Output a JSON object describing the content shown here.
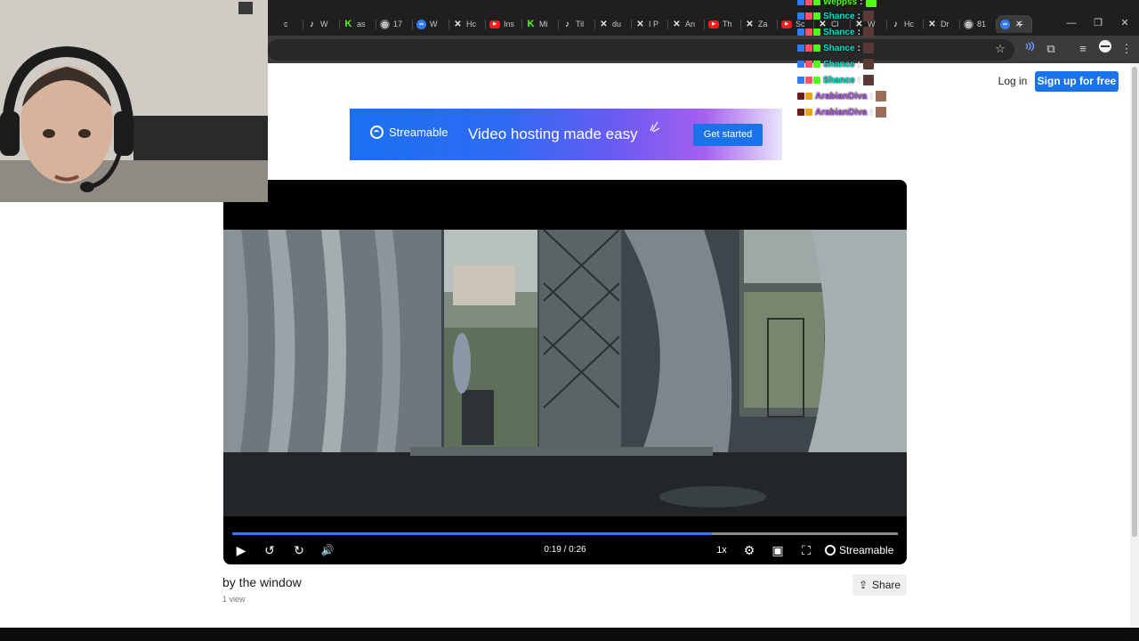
{
  "browser": {
    "tabs": [
      {
        "favicon": "partial-tab",
        "label": "c"
      },
      {
        "favicon": "tiktok-icon",
        "label": "W"
      },
      {
        "favicon": "kick-icon",
        "label": "as"
      },
      {
        "favicon": "globe-icon",
        "label": "17"
      },
      {
        "favicon": "streamable-icon",
        "label": "W"
      },
      {
        "favicon": "x-icon",
        "label": "Hc"
      },
      {
        "favicon": "youtube-icon",
        "label": "Ins"
      },
      {
        "favicon": "kick-icon",
        "label": "Mi"
      },
      {
        "favicon": "tiktok-icon",
        "label": "Til"
      },
      {
        "favicon": "x-icon",
        "label": "du"
      },
      {
        "favicon": "x-icon",
        "label": "I P"
      },
      {
        "favicon": "x-icon",
        "label": "An"
      },
      {
        "favicon": "youtube-icon",
        "label": "Th"
      },
      {
        "favicon": "x-icon",
        "label": "Za"
      },
      {
        "favicon": "youtube-icon",
        "label": "Sc"
      },
      {
        "favicon": "x-icon",
        "label": "Cl"
      },
      {
        "favicon": "x-icon",
        "label": "W"
      },
      {
        "favicon": "tiktok-icon",
        "label": "Hc"
      },
      {
        "favicon": "x-icon",
        "label": "Dr"
      },
      {
        "favicon": "globe-icon",
        "label": "81"
      }
    ],
    "new_tab": "+",
    "window_controls": {
      "minimize": "—",
      "restore": "❐",
      "close": "✕"
    },
    "toolbar": {
      "bookmark": "☆",
      "extension": "⧉",
      "media": "≡",
      "menu": "⋮"
    }
  },
  "header": {
    "login": "Log in",
    "signup": "Sign up for free"
  },
  "banner": {
    "brand": "Streamable",
    "tagline": "Video hosting made easy",
    "cta": "Get started"
  },
  "player": {
    "time": "0:19 / 0:26",
    "progress": 0.72,
    "speed": "1x",
    "brand": "Streamable",
    "icons": {
      "play": "▶",
      "rewind": "↺",
      "forward": "↻",
      "volume": "🔊",
      "settings": "⚙",
      "pip": "▣",
      "fullscreen": "⛶"
    }
  },
  "video": {
    "title": "by the window",
    "views": "1 view",
    "share": "Share",
    "share_icon": "⇪"
  },
  "chat": {
    "messages": [
      {
        "user": "Weppss",
        "color": "#53fc18"
      },
      {
        "user": "Shance",
        "color": "#00e5d0"
      },
      {
        "user": "Shance",
        "color": "#00e5d0"
      },
      {
        "user": "Shance",
        "color": "#00e5d0"
      },
      {
        "user": "Shance",
        "color": "#00e5d0"
      },
      {
        "user": "Shance",
        "color": "#00e5d0"
      },
      {
        "user": "ArabianDiva",
        "color": "#b45cf0"
      },
      {
        "user": "ArabianDiva",
        "color": "#b45cf0"
      }
    ]
  },
  "colors": {
    "accent": "#1a73e8",
    "progress": "#2f7cf6",
    "chrome_dark": "#1f1f1f"
  }
}
